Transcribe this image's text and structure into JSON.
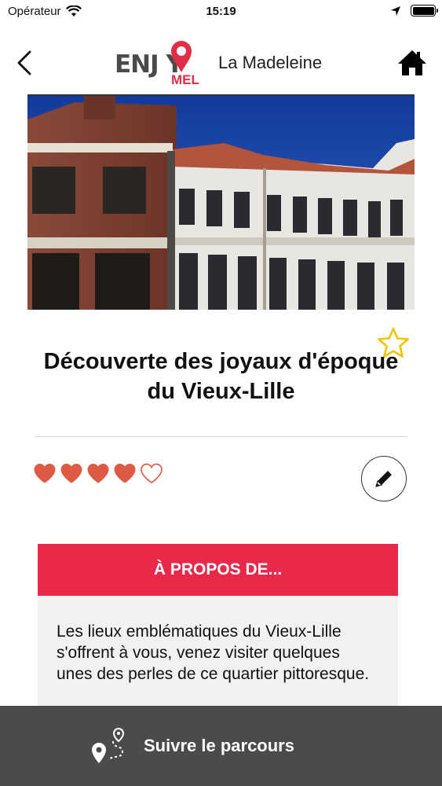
{
  "status_bar": {
    "carrier": "Opérateur",
    "time": "15:19"
  },
  "nav": {
    "logo_word": "ENJ Y",
    "logo_sub": "MEL",
    "city": "La Madeleine",
    "back_icon": "chevron-left-icon",
    "home_icon": "home-icon"
  },
  "detail": {
    "title": "Découverte des joyaux d'époque du Vieux-Lille",
    "rating": {
      "value": 4,
      "max": 5
    },
    "favorite_icon": "star-outline-icon",
    "edit_icon": "pencil-icon"
  },
  "about": {
    "heading": "À PROPOS DE...",
    "text": "Les lieux emblématiques du Vieux-Lille s'offrent à vous, venez visiter quelques unes des perles de ce quartier pittoresque."
  },
  "footer": {
    "label": "Suivre le parcours",
    "icon": "route-icon"
  },
  "colors": {
    "accent": "#e8294a",
    "heart": "#dd5a45",
    "star": "#f2c400",
    "footer_bg": "#4b4b4b"
  }
}
